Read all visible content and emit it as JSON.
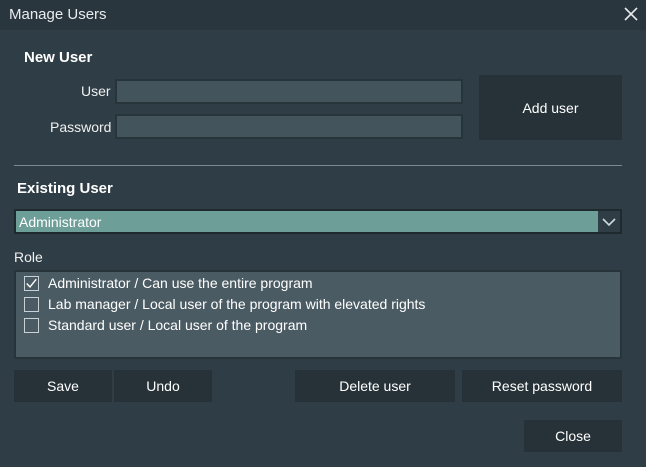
{
  "window": {
    "title": "Manage Users"
  },
  "new_user": {
    "heading": "New User",
    "user_label": "User",
    "user_placeholder": "",
    "password_label": "Password",
    "password_placeholder": "",
    "add_button": "Add user"
  },
  "existing_user": {
    "heading": "Existing User",
    "selected": "Administrator"
  },
  "role": {
    "label": "Role",
    "items": [
      {
        "label": "Administrator / Can use the entire program",
        "checked": true
      },
      {
        "label": "Lab manager / Local user of the program with elevated rights",
        "checked": false
      },
      {
        "label": "Standard user / Local user of the program",
        "checked": false
      }
    ]
  },
  "buttons": {
    "save": "Save",
    "undo": "Undo",
    "delete": "Delete user",
    "reset": "Reset password",
    "close": "Close"
  },
  "colors": {
    "background": "#2f3e46",
    "button": "#263238",
    "select": "#6d9e98",
    "role_box": "#4b5b63"
  }
}
